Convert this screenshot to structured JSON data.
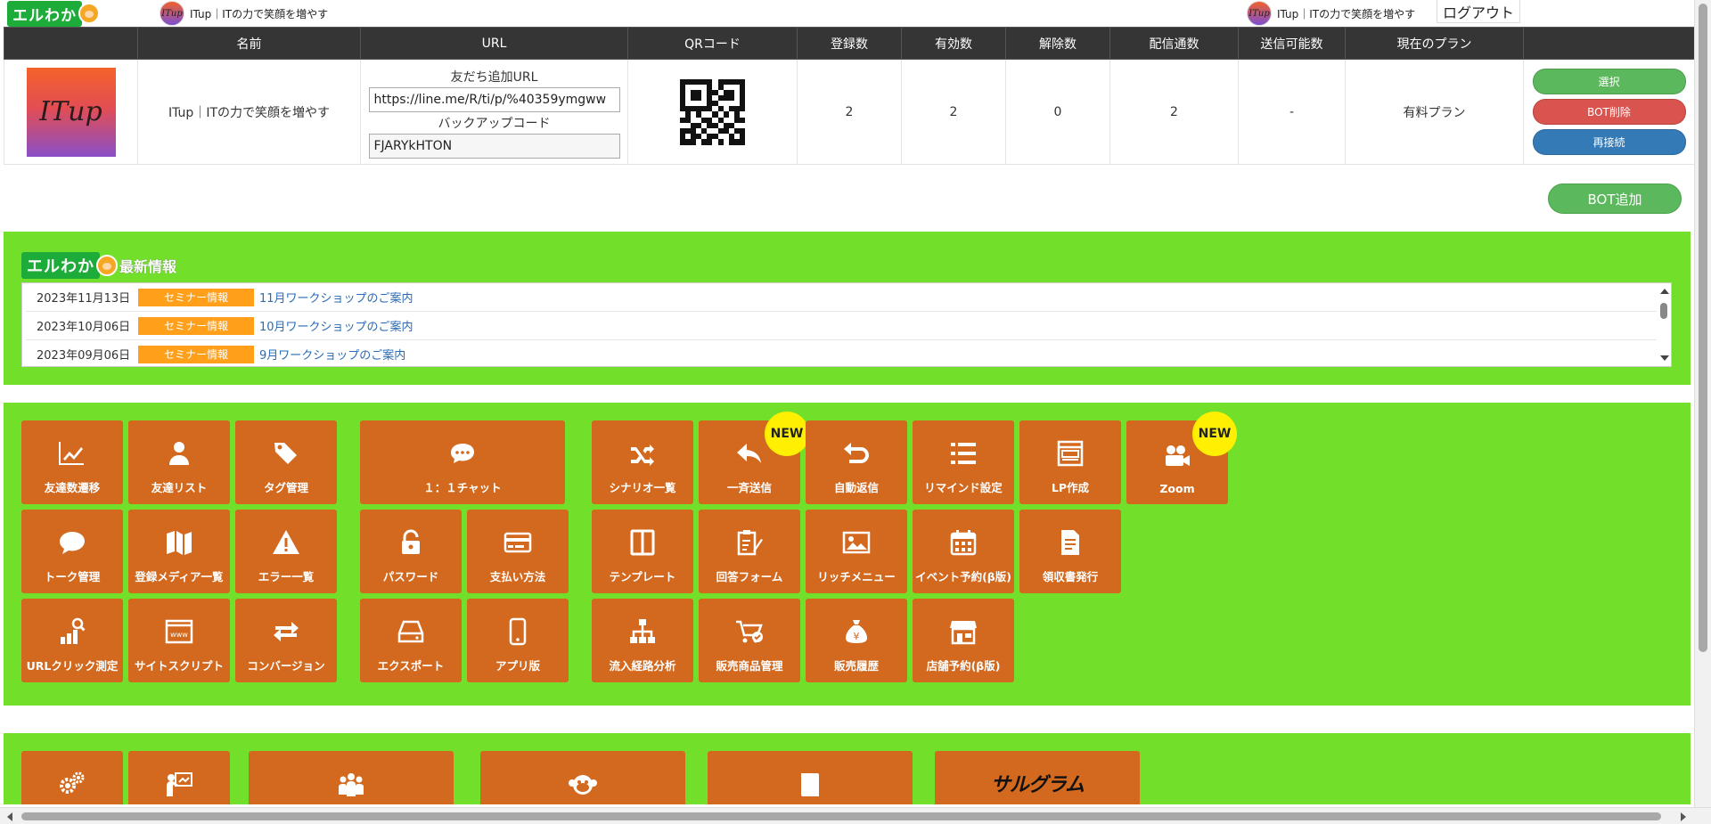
{
  "header": {
    "logo_text": "エルわか",
    "account_name": "ITup｜ITの力で笑顔を増やす",
    "account_avatar_text": "ITup",
    "logout_label": "ログアウト"
  },
  "table": {
    "headers": [
      "",
      "名前",
      "URL",
      "QRコード",
      "登録数",
      "有効数",
      "解除数",
      "配信通数",
      "送信可能数",
      "現在のプラン",
      ""
    ],
    "row": {
      "icon_text": "ITup",
      "name": "ITup｜ITの力で笑顔を増やす",
      "friend_url_label": "友だち追加URL",
      "friend_url_value": "https://line.me/R/ti/p/%40359ymgww",
      "backup_code_label": "バックアップコード",
      "backup_code_value": "FJARYkHTON",
      "registered": "2",
      "active": "2",
      "unsubscribed": "0",
      "deliveries": "2",
      "sendable": "-",
      "plan": "有料プラン",
      "select_label": "選択",
      "delete_label": "BOT削除",
      "reconnect_label": "再接続"
    },
    "bot_add_label": "BOT追加"
  },
  "news": {
    "logo_text": "エルわか",
    "title": "最新情報",
    "items": [
      {
        "date": "2023年11月13日",
        "category": "セミナー情報",
        "title": "11月ワークショップのご案内"
      },
      {
        "date": "2023年10月06日",
        "category": "セミナー情報",
        "title": "10月ワークショップのご案内"
      },
      {
        "date": "2023年09月06日",
        "category": "セミナー情報",
        "title": "9月ワークショップのご案内"
      }
    ]
  },
  "menu": {
    "tiles": [
      {
        "label": "友達数遷移",
        "icon": "chart-line-icon"
      },
      {
        "label": "友達リスト",
        "icon": "user-icon"
      },
      {
        "label": "タグ管理",
        "icon": "tags-icon"
      },
      {
        "label": "１：１チャット",
        "icon": "chat-bubble-icon"
      },
      {
        "label": "シナリオ一覧",
        "icon": "shuffle-icon"
      },
      {
        "label": "一斉送信",
        "icon": "reply-icon",
        "badge": "NEW"
      },
      {
        "label": "自動返信",
        "icon": "undo-icon"
      },
      {
        "label": "リマインド設定",
        "icon": "list-icon"
      },
      {
        "label": "LP作成",
        "icon": "webpage-icon"
      },
      {
        "label": "Zoom",
        "icon": "video-camera-icon",
        "badge": "NEW"
      },
      {
        "label": "トーク管理",
        "icon": "comment-icon"
      },
      {
        "label": "登録メディア一覧",
        "icon": "map-icon"
      },
      {
        "label": "エラー一覧",
        "icon": "warning-icon"
      },
      {
        "label": "パスワード",
        "icon": "lock-icon"
      },
      {
        "label": "支払い方法",
        "icon": "credit-card-icon"
      },
      {
        "label": "テンプレート",
        "icon": "columns-icon"
      },
      {
        "label": "回答フォーム",
        "icon": "clipboard-edit-icon"
      },
      {
        "label": "リッチメニュー",
        "icon": "image-icon"
      },
      {
        "label": "イベント予約(β版)",
        "icon": "calendar-icon"
      },
      {
        "label": "領収書発行",
        "icon": "receipt-icon"
      },
      {
        "label": "URLクリック測定",
        "icon": "bar-search-icon"
      },
      {
        "label": "サイトスクリプト",
        "icon": "browser-www-icon"
      },
      {
        "label": "コンバージョン",
        "icon": "exchange-icon"
      },
      {
        "label": "エクスポート",
        "icon": "hdd-icon"
      },
      {
        "label": "アプリ版",
        "icon": "mobile-icon"
      },
      {
        "label": "流入経路分析",
        "icon": "sitemap-icon"
      },
      {
        "label": "販売商品管理",
        "icon": "cart-check-icon"
      },
      {
        "label": "販売履歴",
        "icon": "money-bag-icon"
      },
      {
        "label": "店舗予約(β版)",
        "icon": "store-icon"
      }
    ],
    "bottom_tiles": [
      {
        "icon": "gears-icon"
      },
      {
        "icon": "teacher-icon"
      },
      {
        "icon": "group-icon"
      },
      {
        "icon": "monkey-face-icon"
      },
      {
        "icon": "book-icon"
      },
      {
        "text": "サルグラム",
        "icon": "sarugram-logo"
      }
    ]
  },
  "colors": {
    "green_panel": "#72e02a",
    "tile_orange": "#d2691e",
    "badge_yellow": "#ffef00",
    "header_dark": "#353535",
    "news_category": "#ff9f1a"
  }
}
